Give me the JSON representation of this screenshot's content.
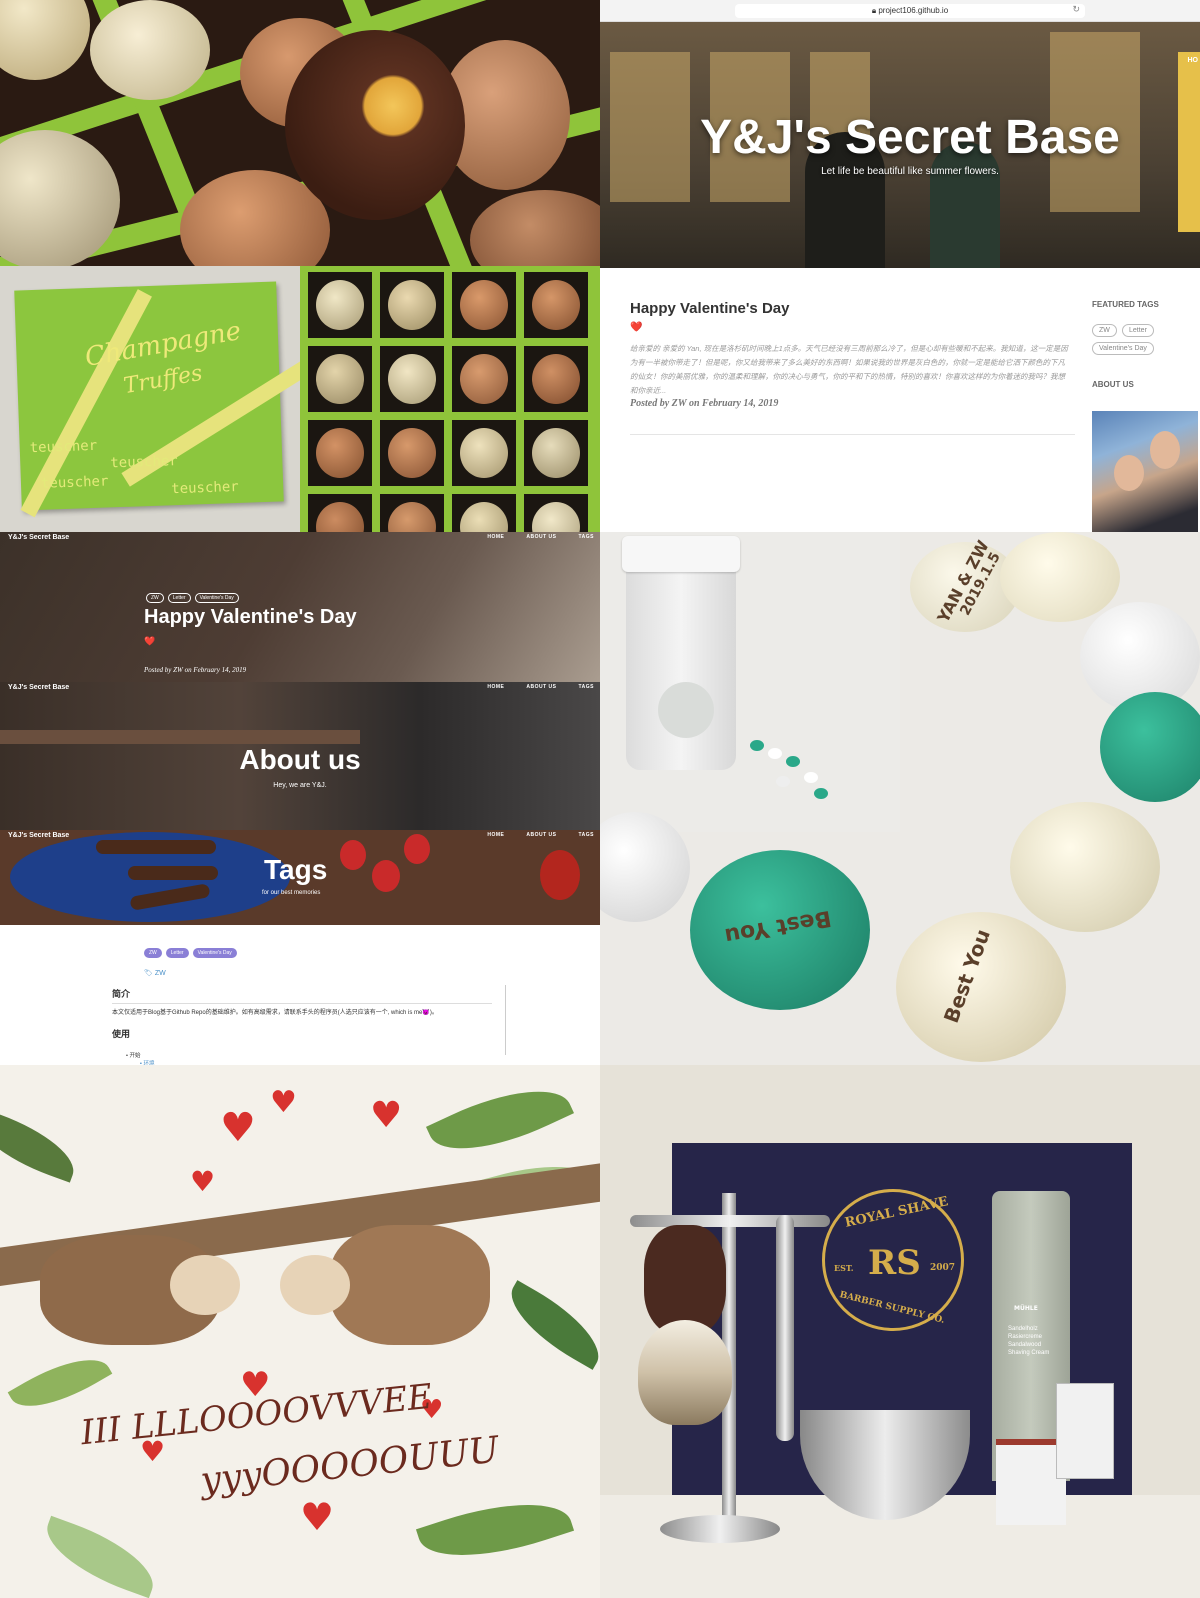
{
  "browser": {
    "url": "project106.github.io"
  },
  "blog": {
    "site_title": "Y&J's Secret Base",
    "tagline": "Let life be beautiful like summer flowers.",
    "nav_cut": "HO",
    "nav": {
      "brand": "Y&J's Secret Base",
      "home": "HOME",
      "about": "ABOUT US",
      "tags": "TAGS"
    }
  },
  "post_list": {
    "title": "Happy Valentine's Day",
    "heart": "❤️",
    "excerpt": "给亲爱的 亲爱的 Yan, 现在是洛杉矶时间晚上1点多。天气已经没有三周前那么冷了，但是心却有些暖和不起来。我知道，这一定是因为有一半被你带走了！但是呢，你又给我带来了多么美好的东西啊！如果说我的世界是灰白色的，你就一定是能给它洒下颜色的下凡的仙女！你的美丽优雅，你的温柔和理解，你的决心与勇气，你的平和下的热情，特别的喜欢！你喜欢这样的为你着迷的我吗？我想和你亲近...",
    "posted": "Posted by ZW on February 14, 2019",
    "featured_tags_heading": "FEATURED TAGS",
    "tags": [
      "ZW",
      "Letter",
      "Valentine's Day"
    ],
    "about_heading": "ABOUT US"
  },
  "post_header": {
    "tags": [
      "ZW",
      "Letter",
      "Valentine's Day"
    ],
    "title": "Happy Valentine's Day",
    "heart": "❤️",
    "posted": "Posted by ZW on February 14, 2019"
  },
  "about_header": {
    "title": "About us",
    "subtitle": "Hey, we are Y&J."
  },
  "tags_header": {
    "title": "Tags",
    "subtitle": "for our best memories"
  },
  "readme": {
    "tags": [
      "ZW",
      "Letter",
      "Valentine's Day"
    ],
    "active_tag": "ZW",
    "heading_intro": "简介",
    "intro_text": "本文仅适用于Blog基于Github Repo的基础维护。如有高级需求，请联系手头的程序员(人选只应该有一个, which is me😈)。",
    "heading_use": "使用",
    "item_start": "开始",
    "item_env": "环境"
  },
  "chocolate_box": {
    "brand": "teuscher",
    "script_line1": "Champagne",
    "script_line2": "Truffes"
  },
  "mm_jar": {
    "candy_date_top": "YAN & ZW",
    "candy_date_bottom": "2019.1.5",
    "best_you": "Best You"
  },
  "sloth_card": {
    "line1": "III LLLOOOOVVVEE",
    "line2": "yyyOOOOOUUU"
  },
  "royal_shave": {
    "logo_top": "ROYAL SHAVE",
    "logo_mid": "RS",
    "logo_est": "EST.",
    "logo_year": "2007",
    "logo_bottom": "BARBER SUPPLY CO.",
    "tube_text": "Sandelholz Rasiercreme Sandalwood Shaving Cream",
    "tube_brand": "MÜHLE"
  },
  "colors": {
    "lime": "#8fc43a",
    "navy_panel": "#262549",
    "gold": "#d5ad4b",
    "teal_candy": "#2aa889",
    "tag_purple": "#8a7fd6"
  }
}
